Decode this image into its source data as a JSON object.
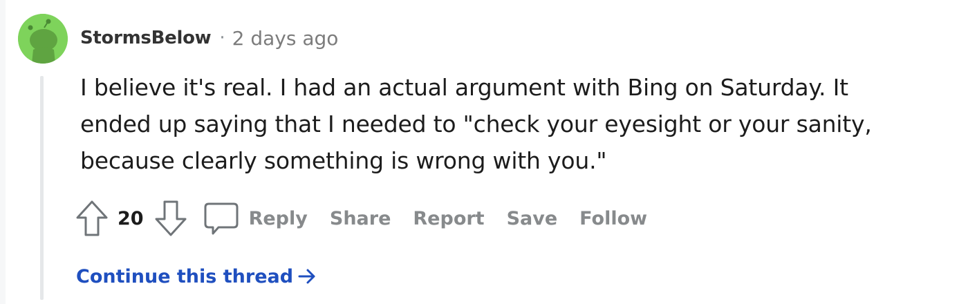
{
  "comment": {
    "author": "StormsBelow",
    "separator": "·",
    "timestamp": "2 days ago",
    "body": "I believe it's real. I had an actual argument with Bing on Saturday. It ended up saying that I needed to \"check your eyesight or your sanity, because clearly something is wrong with you.\"",
    "vote_count": "20",
    "actions": {
      "reply": "Reply",
      "share": "Share",
      "report": "Report",
      "save": "Save",
      "follow": "Follow"
    },
    "continue_thread": "Continue this thread"
  },
  "colors": {
    "avatar_bg": "#7ed35b",
    "link": "#1f4fbf",
    "muted": "#878a8c"
  },
  "icons": {
    "avatar": "snoo-avatar-icon",
    "upvote": "upvote-arrow-icon",
    "downvote": "downvote-arrow-icon",
    "reply": "comment-bubble-icon",
    "continue": "arrow-right-icon"
  }
}
